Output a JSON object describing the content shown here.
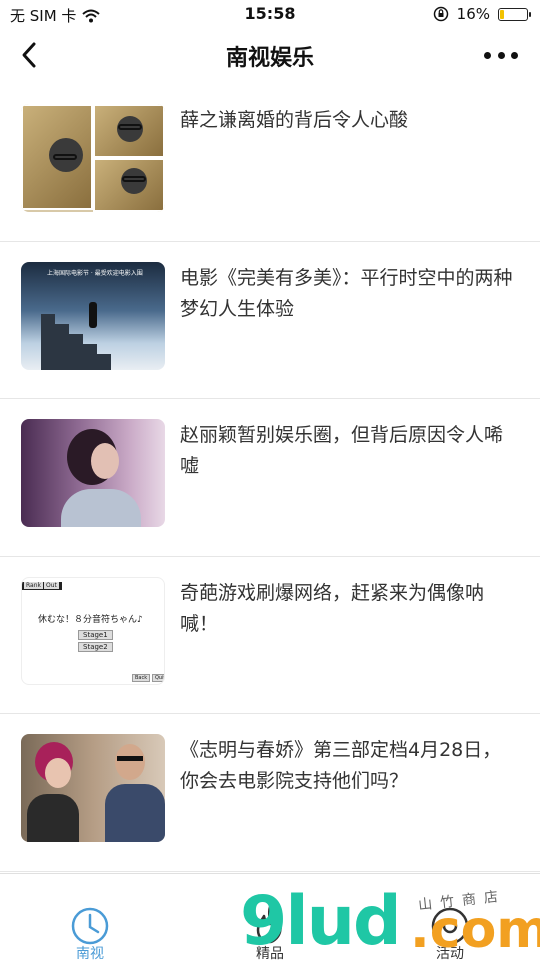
{
  "status_bar": {
    "carrier": "无 SIM 卡",
    "time": "15:58",
    "battery_percent": "16%",
    "battery_level": 0.16,
    "icons": [
      "wifi-icon",
      "orientation-lock-icon",
      "battery-icon"
    ]
  },
  "nav": {
    "title": "南视娱乐",
    "back_icon": "chevron-left-icon",
    "more_icon": "more-dots-icon"
  },
  "news": [
    {
      "title": "薛之谦离婚的背后令人心酸"
    },
    {
      "title": "电影《完美有多美》：平行时空中的两种梦幻人生体验",
      "thumb_caption": "上海国际电影节 · 最受欢迎电影入围"
    },
    {
      "title": "赵丽颖暂别娱乐圈，但背后原因令人唏嘘"
    },
    {
      "title": "奇葩游戏刷爆网络，赶紧来为偶像呐喊！",
      "thumb_game": {
        "rank": "Rank",
        "out": "Out",
        "heading": "休むな！８分音符ちゃん♪",
        "stage1": "Stage1",
        "stage2": "Stage2",
        "back": "Back",
        "quit": "Quit"
      }
    },
    {
      "title": "《志明与春娇》第三部定档4月28日，你会去电影院支持他们吗？"
    }
  ],
  "tabs": [
    {
      "label": "南视",
      "icon": "clock-icon",
      "active": true
    },
    {
      "label": "精品",
      "icon": "fire-icon",
      "active": false
    },
    {
      "label": "活动",
      "icon": "target-icon",
      "active": false
    }
  ],
  "watermark": {
    "main": "9lud",
    "suffix": ".com",
    "small": "山竹商店"
  },
  "colors": {
    "accent": "#4a9bd6",
    "watermark_green": "#1fc7a5",
    "watermark_orange": "#f2a021",
    "battery_yellow": "#f2c200"
  }
}
